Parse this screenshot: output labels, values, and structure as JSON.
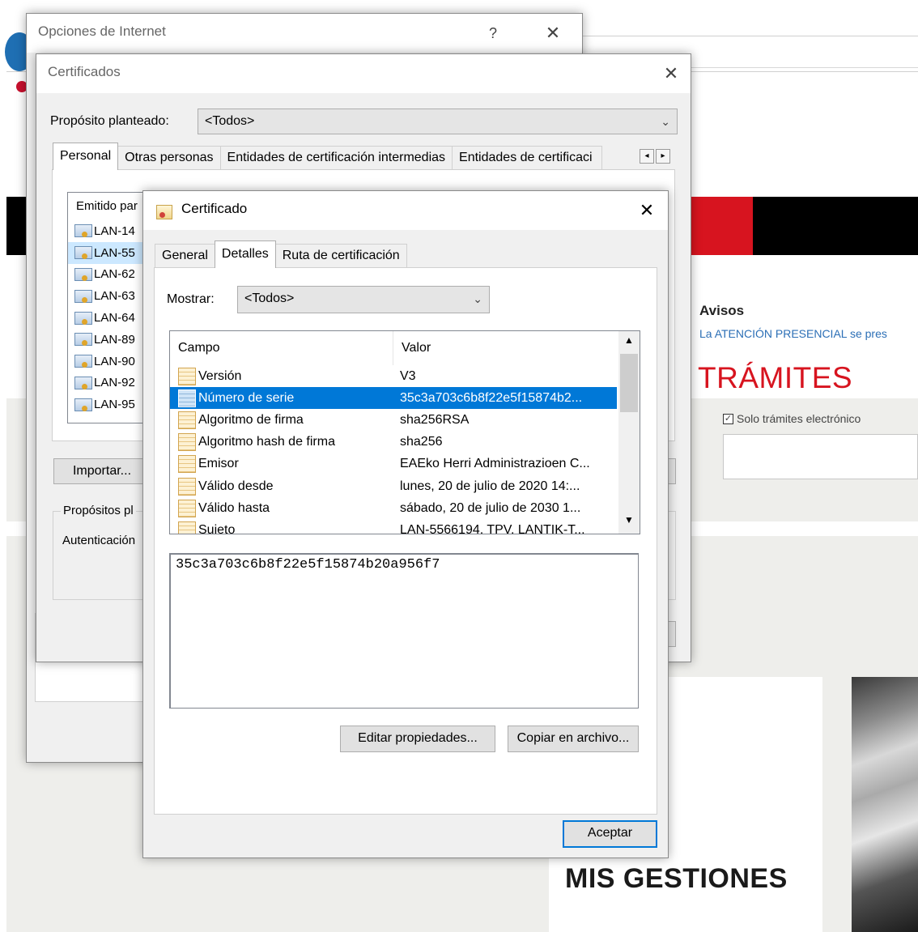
{
  "background": {
    "avisos_heading": "Avisos",
    "avisos_link": "La ATENCIÓN PRESENCIAL se pres",
    "tramites_heading": "TRÁMITES",
    "solo_tramites_label": "Solo trámites electrónico",
    "solo_tramites_checked": "✓",
    "mis_gestiones": "MIS GESTIONES",
    "brand_red": "#d7141f",
    "link_blue": "#2c6fb6"
  },
  "internet_options": {
    "title": "Opciones de Internet",
    "help_glyph": "?",
    "close_glyph": "✕"
  },
  "certificates": {
    "title": "Certificados",
    "close_glyph": "✕",
    "purpose_label": "Propósito planteado:",
    "purpose_value": "<Todos>",
    "tabs": [
      {
        "label": "Personal"
      },
      {
        "label": "Otras personas"
      },
      {
        "label": "Entidades de certificación intermedias"
      },
      {
        "label": "Entidades de certificaci"
      }
    ],
    "scroll_left": "◂",
    "scroll_right": "▸",
    "list_header": "Emitido par",
    "items": [
      "LAN-14",
      "LAN-55",
      "LAN-62",
      "LAN-63",
      "LAN-64",
      "LAN-89",
      "LAN-90",
      "LAN-92",
      "LAN-95"
    ],
    "import_button": "Importar...",
    "purposes_group": "Propósitos pl",
    "purposes_value": "Autenticación"
  },
  "certificate": {
    "title": "Certificado",
    "close_glyph": "✕",
    "tabs": [
      {
        "label": "General"
      },
      {
        "label": "Detalles"
      },
      {
        "label": "Ruta de certificación"
      }
    ],
    "show_label": "Mostrar:",
    "show_value": "<Todos>",
    "columns": {
      "field": "Campo",
      "value": "Valor"
    },
    "rows": [
      {
        "field": "Versión",
        "value": "V3"
      },
      {
        "field": "Número de serie",
        "value": "35c3a703c6b8f22e5f15874b2..."
      },
      {
        "field": "Algoritmo de firma",
        "value": "sha256RSA"
      },
      {
        "field": "Algoritmo hash de firma",
        "value": "sha256"
      },
      {
        "field": "Emisor",
        "value": "EAEko Herri Administrazioen C..."
      },
      {
        "field": "Válido desde",
        "value": "lunes, 20 de julio de 2020 14:..."
      },
      {
        "field": "Válido hasta",
        "value": "sábado, 20 de julio de 2030 1..."
      },
      {
        "field": "Sujeto",
        "value": "LAN-5566194, TPV, LANTIK-T..."
      }
    ],
    "selected_value": "35c3a703c6b8f22e5f15874b20a956f7",
    "edit_button": "Editar propiedades...",
    "copy_button": "Copiar en archivo...",
    "accept_button": "Aceptar",
    "scroll_up": "▲",
    "scroll_down": "▼",
    "combo_chevron": "⌄",
    "accent": "#0078d7"
  }
}
